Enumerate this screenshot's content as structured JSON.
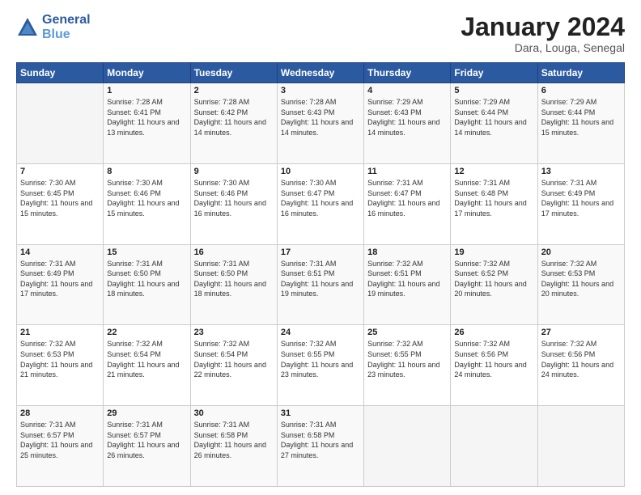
{
  "header": {
    "logo_line1": "General",
    "logo_line2": "Blue",
    "month_title": "January 2024",
    "subtitle": "Dara, Louga, Senegal"
  },
  "weekdays": [
    "Sunday",
    "Monday",
    "Tuesday",
    "Wednesday",
    "Thursday",
    "Friday",
    "Saturday"
  ],
  "weeks": [
    [
      {
        "day": "",
        "sunrise": "",
        "sunset": "",
        "daylight": ""
      },
      {
        "day": "1",
        "sunrise": "Sunrise: 7:28 AM",
        "sunset": "Sunset: 6:41 PM",
        "daylight": "Daylight: 11 hours and 13 minutes."
      },
      {
        "day": "2",
        "sunrise": "Sunrise: 7:28 AM",
        "sunset": "Sunset: 6:42 PM",
        "daylight": "Daylight: 11 hours and 14 minutes."
      },
      {
        "day": "3",
        "sunrise": "Sunrise: 7:28 AM",
        "sunset": "Sunset: 6:43 PM",
        "daylight": "Daylight: 11 hours and 14 minutes."
      },
      {
        "day": "4",
        "sunrise": "Sunrise: 7:29 AM",
        "sunset": "Sunset: 6:43 PM",
        "daylight": "Daylight: 11 hours and 14 minutes."
      },
      {
        "day": "5",
        "sunrise": "Sunrise: 7:29 AM",
        "sunset": "Sunset: 6:44 PM",
        "daylight": "Daylight: 11 hours and 14 minutes."
      },
      {
        "day": "6",
        "sunrise": "Sunrise: 7:29 AM",
        "sunset": "Sunset: 6:44 PM",
        "daylight": "Daylight: 11 hours and 15 minutes."
      }
    ],
    [
      {
        "day": "7",
        "sunrise": "Sunrise: 7:30 AM",
        "sunset": "Sunset: 6:45 PM",
        "daylight": "Daylight: 11 hours and 15 minutes."
      },
      {
        "day": "8",
        "sunrise": "Sunrise: 7:30 AM",
        "sunset": "Sunset: 6:46 PM",
        "daylight": "Daylight: 11 hours and 15 minutes."
      },
      {
        "day": "9",
        "sunrise": "Sunrise: 7:30 AM",
        "sunset": "Sunset: 6:46 PM",
        "daylight": "Daylight: 11 hours and 16 minutes."
      },
      {
        "day": "10",
        "sunrise": "Sunrise: 7:30 AM",
        "sunset": "Sunset: 6:47 PM",
        "daylight": "Daylight: 11 hours and 16 minutes."
      },
      {
        "day": "11",
        "sunrise": "Sunrise: 7:31 AM",
        "sunset": "Sunset: 6:47 PM",
        "daylight": "Daylight: 11 hours and 16 minutes."
      },
      {
        "day": "12",
        "sunrise": "Sunrise: 7:31 AM",
        "sunset": "Sunset: 6:48 PM",
        "daylight": "Daylight: 11 hours and 17 minutes."
      },
      {
        "day": "13",
        "sunrise": "Sunrise: 7:31 AM",
        "sunset": "Sunset: 6:49 PM",
        "daylight": "Daylight: 11 hours and 17 minutes."
      }
    ],
    [
      {
        "day": "14",
        "sunrise": "Sunrise: 7:31 AM",
        "sunset": "Sunset: 6:49 PM",
        "daylight": "Daylight: 11 hours and 17 minutes."
      },
      {
        "day": "15",
        "sunrise": "Sunrise: 7:31 AM",
        "sunset": "Sunset: 6:50 PM",
        "daylight": "Daylight: 11 hours and 18 minutes."
      },
      {
        "day": "16",
        "sunrise": "Sunrise: 7:31 AM",
        "sunset": "Sunset: 6:50 PM",
        "daylight": "Daylight: 11 hours and 18 minutes."
      },
      {
        "day": "17",
        "sunrise": "Sunrise: 7:31 AM",
        "sunset": "Sunset: 6:51 PM",
        "daylight": "Daylight: 11 hours and 19 minutes."
      },
      {
        "day": "18",
        "sunrise": "Sunrise: 7:32 AM",
        "sunset": "Sunset: 6:51 PM",
        "daylight": "Daylight: 11 hours and 19 minutes."
      },
      {
        "day": "19",
        "sunrise": "Sunrise: 7:32 AM",
        "sunset": "Sunset: 6:52 PM",
        "daylight": "Daylight: 11 hours and 20 minutes."
      },
      {
        "day": "20",
        "sunrise": "Sunrise: 7:32 AM",
        "sunset": "Sunset: 6:53 PM",
        "daylight": "Daylight: 11 hours and 20 minutes."
      }
    ],
    [
      {
        "day": "21",
        "sunrise": "Sunrise: 7:32 AM",
        "sunset": "Sunset: 6:53 PM",
        "daylight": "Daylight: 11 hours and 21 minutes."
      },
      {
        "day": "22",
        "sunrise": "Sunrise: 7:32 AM",
        "sunset": "Sunset: 6:54 PM",
        "daylight": "Daylight: 11 hours and 21 minutes."
      },
      {
        "day": "23",
        "sunrise": "Sunrise: 7:32 AM",
        "sunset": "Sunset: 6:54 PM",
        "daylight": "Daylight: 11 hours and 22 minutes."
      },
      {
        "day": "24",
        "sunrise": "Sunrise: 7:32 AM",
        "sunset": "Sunset: 6:55 PM",
        "daylight": "Daylight: 11 hours and 23 minutes."
      },
      {
        "day": "25",
        "sunrise": "Sunrise: 7:32 AM",
        "sunset": "Sunset: 6:55 PM",
        "daylight": "Daylight: 11 hours and 23 minutes."
      },
      {
        "day": "26",
        "sunrise": "Sunrise: 7:32 AM",
        "sunset": "Sunset: 6:56 PM",
        "daylight": "Daylight: 11 hours and 24 minutes."
      },
      {
        "day": "27",
        "sunrise": "Sunrise: 7:32 AM",
        "sunset": "Sunset: 6:56 PM",
        "daylight": "Daylight: 11 hours and 24 minutes."
      }
    ],
    [
      {
        "day": "28",
        "sunrise": "Sunrise: 7:31 AM",
        "sunset": "Sunset: 6:57 PM",
        "daylight": "Daylight: 11 hours and 25 minutes."
      },
      {
        "day": "29",
        "sunrise": "Sunrise: 7:31 AM",
        "sunset": "Sunset: 6:57 PM",
        "daylight": "Daylight: 11 hours and 26 minutes."
      },
      {
        "day": "30",
        "sunrise": "Sunrise: 7:31 AM",
        "sunset": "Sunset: 6:58 PM",
        "daylight": "Daylight: 11 hours and 26 minutes."
      },
      {
        "day": "31",
        "sunrise": "Sunrise: 7:31 AM",
        "sunset": "Sunset: 6:58 PM",
        "daylight": "Daylight: 11 hours and 27 minutes."
      },
      {
        "day": "",
        "sunrise": "",
        "sunset": "",
        "daylight": ""
      },
      {
        "day": "",
        "sunrise": "",
        "sunset": "",
        "daylight": ""
      },
      {
        "day": "",
        "sunrise": "",
        "sunset": "",
        "daylight": ""
      }
    ]
  ]
}
